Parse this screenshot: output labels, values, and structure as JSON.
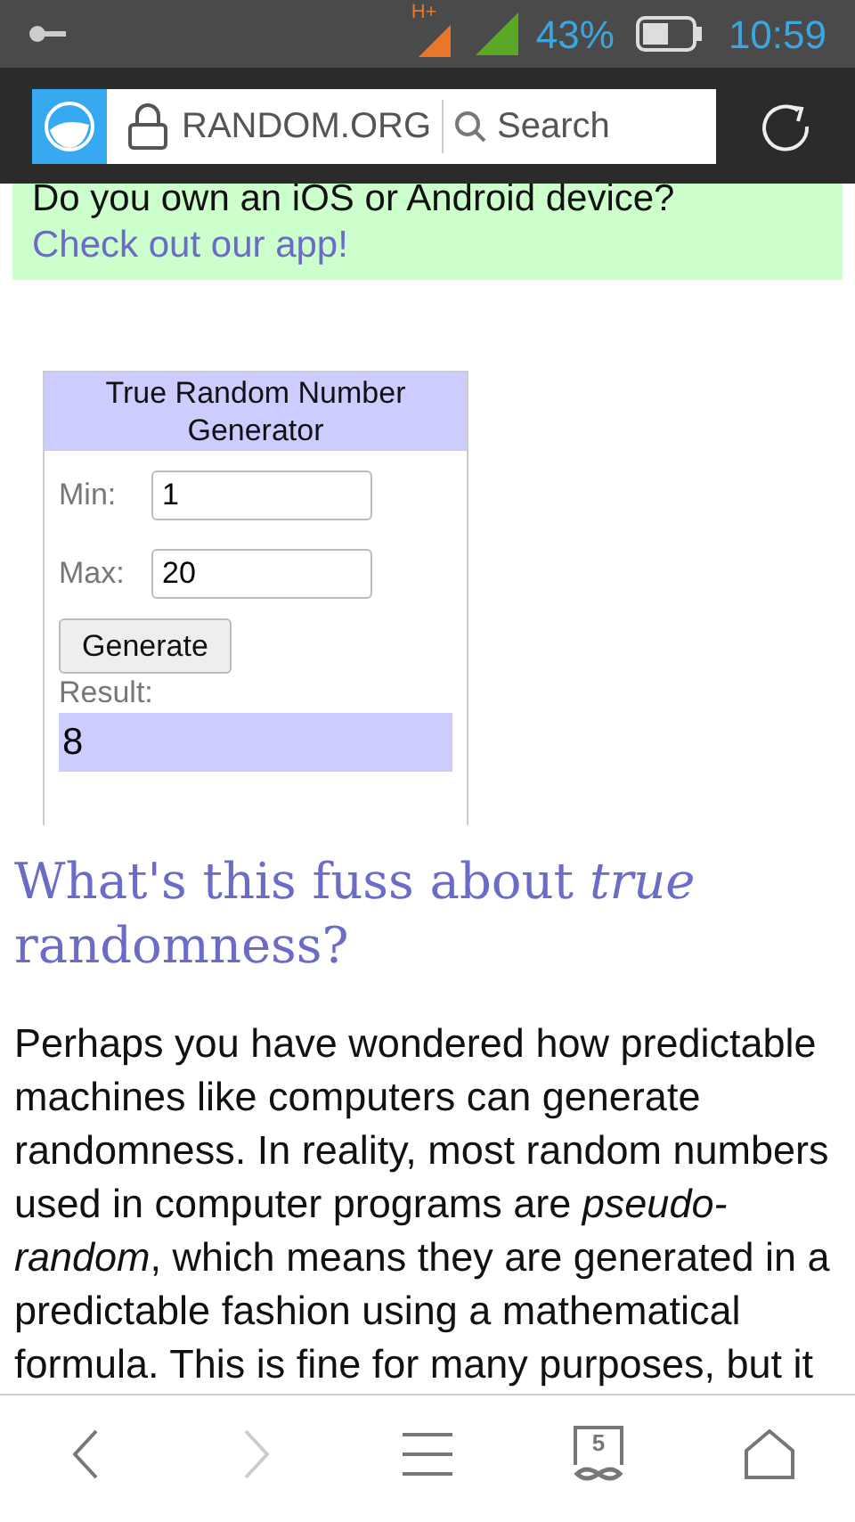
{
  "status_bar": {
    "network": "H+",
    "battery": "43%",
    "time": "10:59"
  },
  "address_bar": {
    "domain": "RANDOM.ORG",
    "search_placeholder": "Search"
  },
  "banner": {
    "question": "Do you own an iOS or Android device?",
    "link": "Check out our app!"
  },
  "widget": {
    "title": "True Random Number Generator",
    "fields": [
      {
        "label": "Min:",
        "value": "1"
      },
      {
        "label": "Max:",
        "value": "20"
      }
    ],
    "button": "Generate",
    "result_label": "Result:",
    "result": "8"
  },
  "article": {
    "heading": "What's this fuss about *true* randomness?",
    "paragraph": "Perhaps you have wondered how predictable machines like computers can generate randomness. In reality, most random numbers used in computer programs are *pseudo-random*, which means they are generated in a predictable fashion using a mathematical formula. This is fine for many purposes, but it"
  },
  "bottom_nav": [
    {
      "kind": "back",
      "disabled": false
    },
    {
      "kind": "forward",
      "disabled": true
    },
    {
      "kind": "menu",
      "disabled": false
    },
    {
      "kind": "tabs",
      "count": "5",
      "disabled": false
    },
    {
      "kind": "home",
      "disabled": false
    }
  ]
}
